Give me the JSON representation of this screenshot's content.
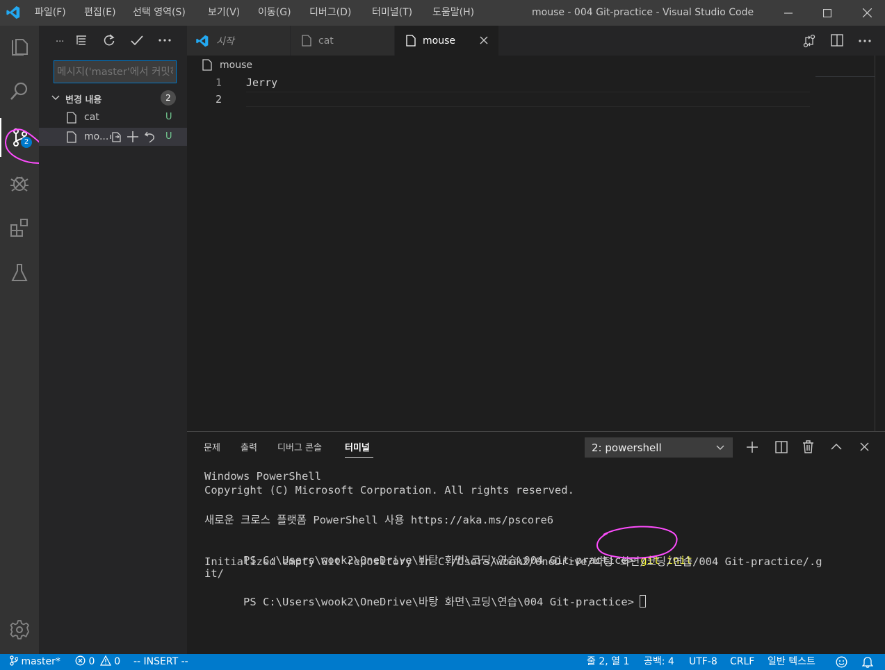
{
  "titlebar": {
    "menus": [
      "파일(F)",
      "편집(E)",
      "선택 영역(S)",
      "보기(V)",
      "이동(G)",
      "디버그(D)",
      "터미널(T)",
      "도움말(H)"
    ],
    "title": "mouse - 004 Git-practice - Visual Studio Code"
  },
  "activitybar": {
    "icons": [
      "explorer-icon",
      "search-icon",
      "source-control-icon",
      "debug-icon",
      "extensions-icon",
      "test-icon",
      "settings-gear-icon"
    ],
    "scm_badge": "2"
  },
  "sidebar": {
    "toolbar_more": "...",
    "commit_placeholder": "메시지('master'에서 커밋하려면 Ctrl+Enter 누르기)",
    "changes_header": "변경 내용",
    "changes_count": "2",
    "files": [
      {
        "name": "cat",
        "status": "U"
      },
      {
        "name": "mo...",
        "status": "U"
      }
    ]
  },
  "tabs": [
    {
      "label": "시작",
      "italic": true
    },
    {
      "label": "cat"
    },
    {
      "label": "mouse",
      "active": true
    }
  ],
  "editor": {
    "breadcrumb": "mouse",
    "line_numbers": [
      "1",
      "2"
    ],
    "lines": [
      "Jerry",
      ""
    ]
  },
  "panel": {
    "tabs": [
      "문제",
      "출력",
      "디버그 콘솔",
      "터미널"
    ],
    "active_tab": "터미널",
    "terminal_select": "2: powershell",
    "terminal_lines": [
      "Windows PowerShell",
      "Copyright (C) Microsoft Corporation. All rights reserved.",
      "",
      "새로운 크로스 플랫폼 PowerShell 사용 https://aka.ms/pscore6",
      "",
      "PS C:\\Users\\wook2\\OneDrive\\바탕 화면\\코딩\\연습\\004 Git-practice>",
      "Initialized empty Git repository in C:/Users/wook2/OneDrive/바탕 화면/코딩/연습/004 Git-practice/.g",
      "it/",
      "PS C:\\Users\\wook2\\OneDrive\\바탕 화면\\코딩\\연습\\004 Git-practice>"
    ],
    "command": " git init"
  },
  "statusbar": {
    "branch": "master*",
    "errors": "0",
    "warnings": "0",
    "mode": "-- INSERT --",
    "position": "줄 2, 열 1",
    "spaces": "공백: 4",
    "encoding": "UTF-8",
    "eol": "CRLF",
    "language": "일반 텍스트"
  },
  "colors": {
    "accent": "#007acc",
    "untracked": "#73c991",
    "annotation": "#ff4dff"
  }
}
